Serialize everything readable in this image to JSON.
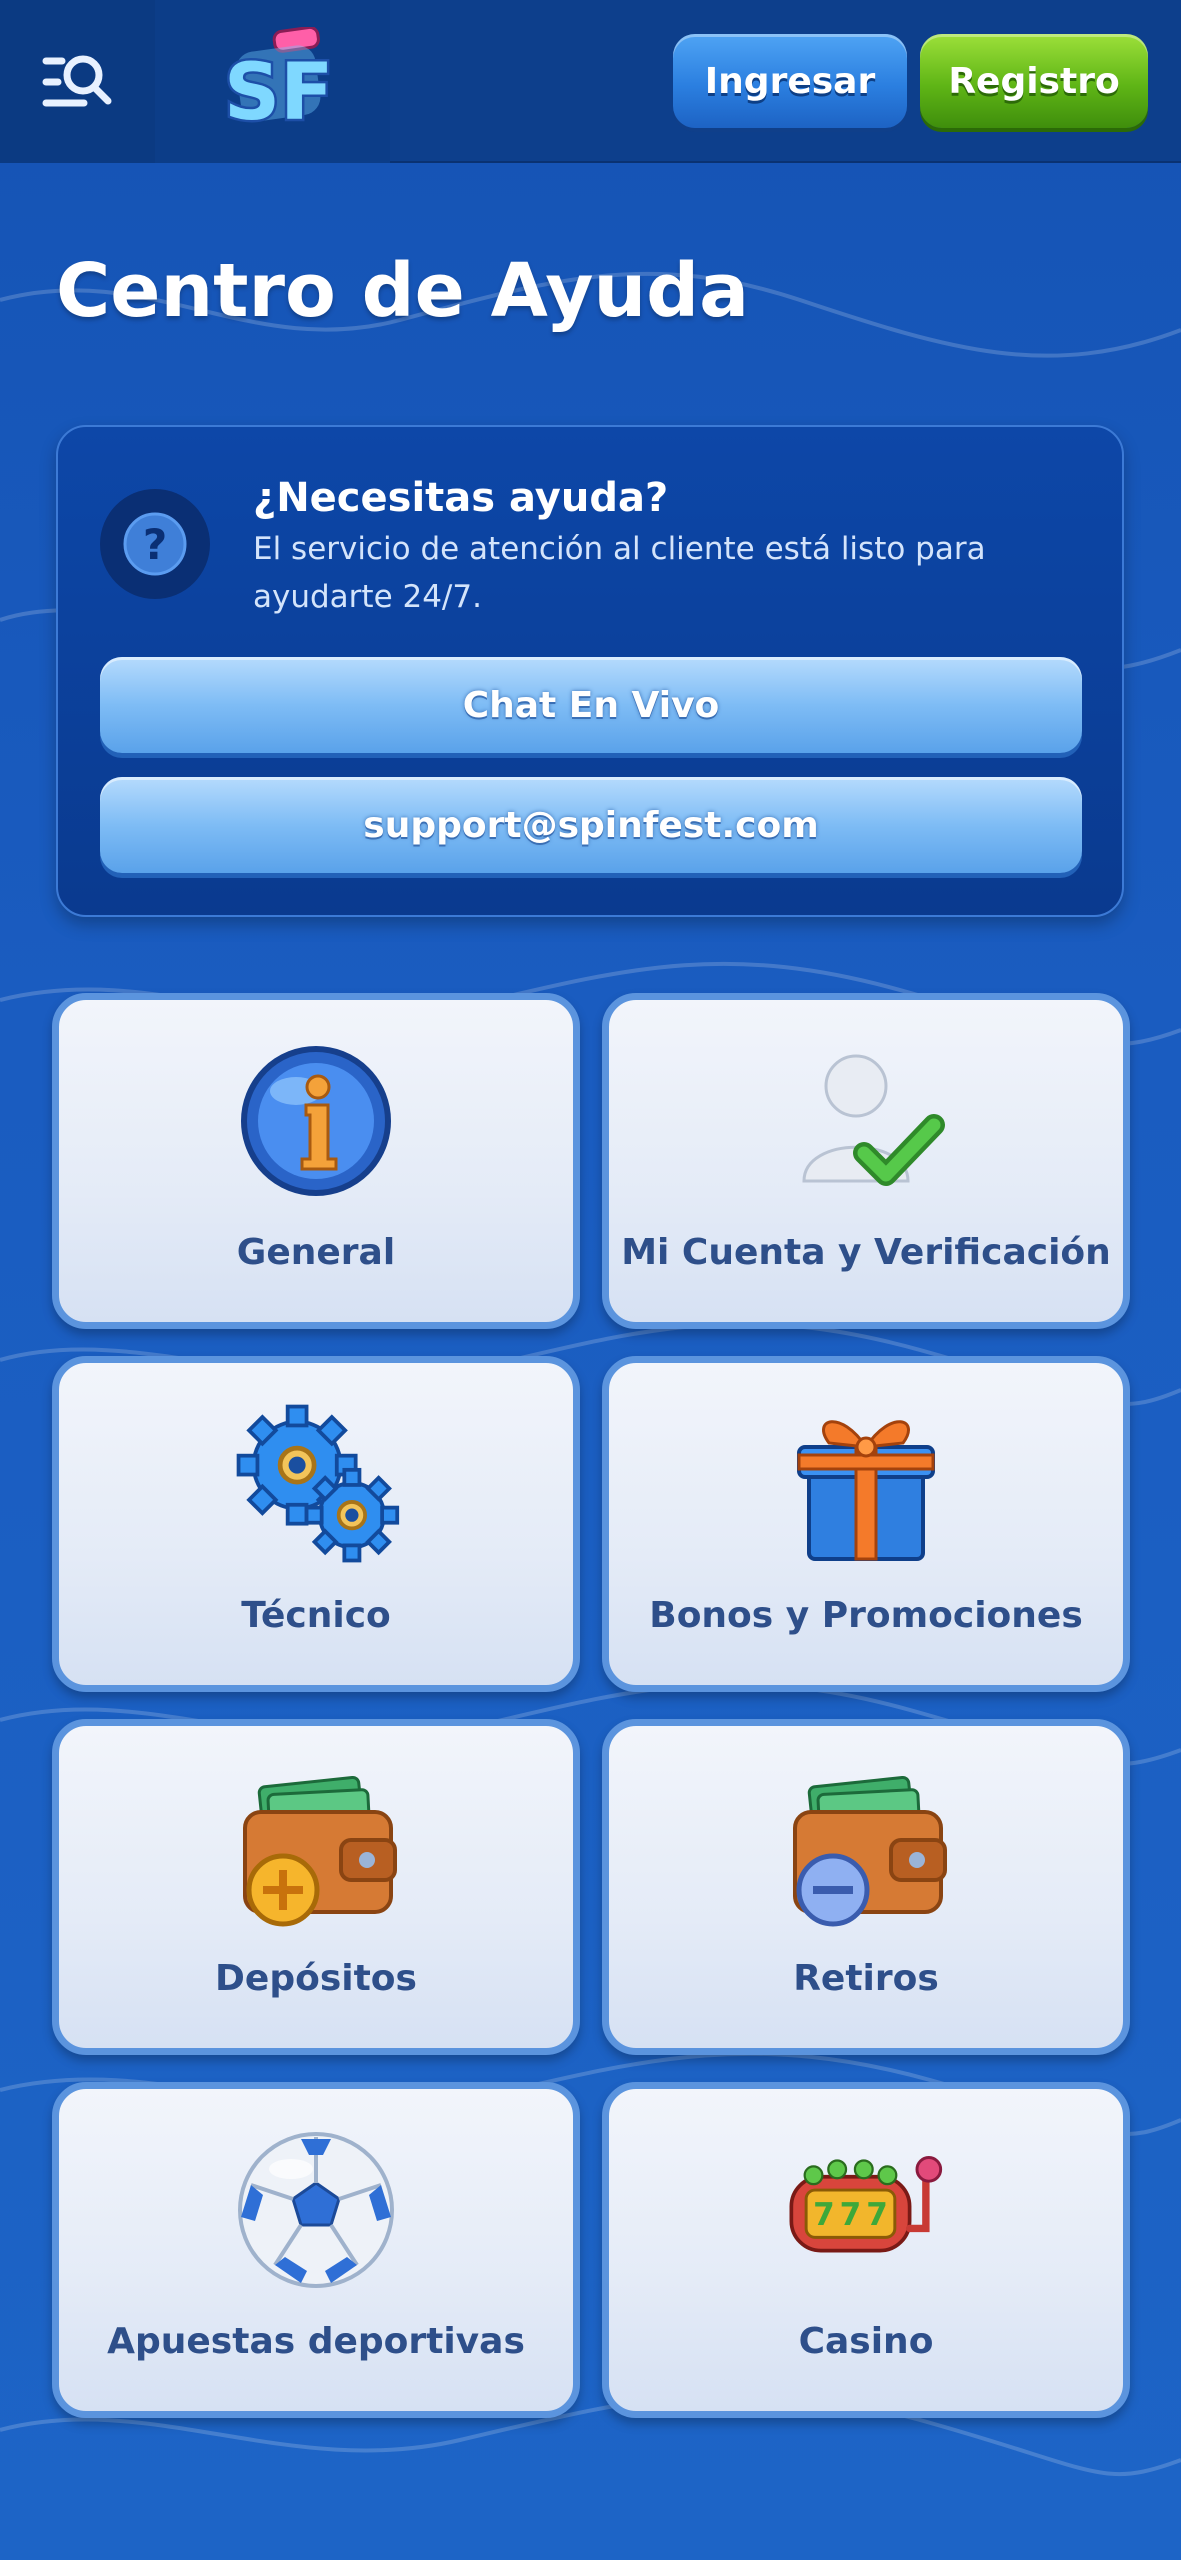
{
  "header": {
    "logo_text": "SF",
    "login_label": "Ingresar",
    "register_label": "Registro"
  },
  "page": {
    "title": "Centro de Ayuda"
  },
  "help": {
    "heading": "¿Necesitas ayuda?",
    "description": "El servicio de atención al cliente está listo para ayudarte 24/7.",
    "chat_label": "Chat En Vivo",
    "email_label": "support@spinfest.com"
  },
  "categories": [
    {
      "label": "General",
      "icon": "info-icon"
    },
    {
      "label": "Mi Cuenta y Verificación",
      "icon": "user-check-icon"
    },
    {
      "label": "Técnico",
      "icon": "gears-icon"
    },
    {
      "label": "Bonos y Promociones",
      "icon": "gift-icon"
    },
    {
      "label": "Depósitos",
      "icon": "wallet-plus-icon"
    },
    {
      "label": "Retiros",
      "icon": "wallet-minus-icon"
    },
    {
      "label": "Apuestas deportivas",
      "icon": "soccer-ball-icon"
    },
    {
      "label": "Casino",
      "icon": "slot-machine-icon"
    }
  ],
  "colors": {
    "background": "#1a5cc0",
    "header": "#0d3f8c",
    "login_button": "#2b7fe0",
    "register_button": "#5fb516",
    "card_border": "#5b94de",
    "card_label": "#2e4f8a"
  }
}
